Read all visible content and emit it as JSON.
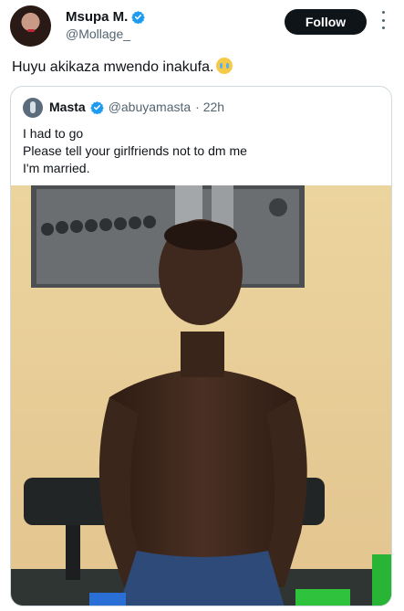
{
  "author": {
    "name": "Msupa M.",
    "handle": "@Mollage_",
    "follow_label": "Follow"
  },
  "tweet": {
    "text": "Huyu akikaza mwendo inakufa.",
    "emoji": "loudly-crying-face"
  },
  "quoted": {
    "name": "Masta",
    "handle": "@abuyamasta",
    "time": "· 22h",
    "lines": [
      "I had to go",
      "Please tell your girlfriends not to dm me",
      "I'm married."
    ]
  },
  "colors": {
    "verified": "#1d9bf0",
    "follow_bg": "#0f1419",
    "secondary_text": "#536471",
    "border": "#cfd9de"
  },
  "icons": {
    "verified": "verified-badge-icon",
    "more": "more-options-icon"
  }
}
